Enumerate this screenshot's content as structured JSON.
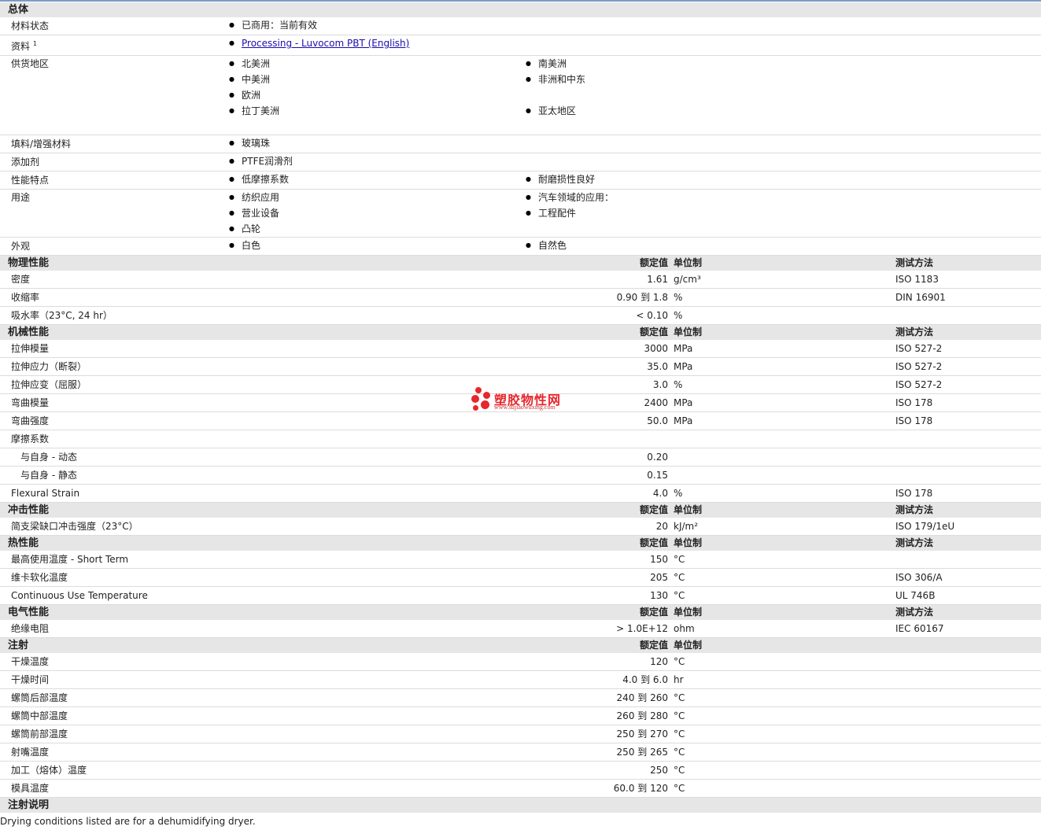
{
  "general": {
    "title": "总体",
    "rows": [
      {
        "label": "材料状态",
        "items": [
          "已商用：当前有效"
        ]
      },
      {
        "label": "资料",
        "sup": "1",
        "link": "Processing - Luvocom PBT (English)"
      },
      {
        "label": "供货地区",
        "items": [
          "北美洲",
          "南美洲",
          "中美洲",
          "非洲和中东",
          "欧洲",
          "",
          "拉丁美洲",
          "亚太地区",
          ""
        ]
      },
      {
        "label": "填料/增强材料",
        "items": [
          "玻璃珠"
        ]
      },
      {
        "label": "添加剂",
        "items": [
          "PTFE润滑剂"
        ]
      },
      {
        "label": "性能特点",
        "items": [
          "低摩擦系数",
          "耐磨损性良好"
        ]
      },
      {
        "label": "用途",
        "items": [
          "纺织应用",
          "汽车领域的应用：",
          "营业设备",
          "工程配件",
          "凸轮",
          ""
        ]
      },
      {
        "label": "外观",
        "items": [
          "白色",
          "自然色"
        ]
      }
    ]
  },
  "col_headers": {
    "value": "额定值",
    "unit": "单位制",
    "method": "测试方法"
  },
  "sections": [
    {
      "title": "物理性能",
      "show_method": true,
      "rows": [
        {
          "label": "密度",
          "value": "1.61",
          "unit": "g/cm³",
          "method": "ISO 1183"
        },
        {
          "label": "收缩率",
          "value": "0.90 到  1.8",
          "unit": "%",
          "method": "DIN 16901"
        },
        {
          "label": "吸水率（23°C, 24 hr）",
          "value": "< 0.10",
          "unit": "%",
          "method": ""
        }
      ]
    },
    {
      "title": "机械性能",
      "show_method": true,
      "rows": [
        {
          "label": "拉伸模量",
          "value": "3000",
          "unit": "MPa",
          "method": "ISO 527-2"
        },
        {
          "label": "拉伸应力（断裂）",
          "value": "35.0",
          "unit": "MPa",
          "method": "ISO 527-2"
        },
        {
          "label": "拉伸应变（屈服）",
          "value": "3.0",
          "unit": "%",
          "method": "ISO 527-2"
        },
        {
          "label": "弯曲模量",
          "value": "2400",
          "unit": "MPa",
          "method": "ISO 178"
        },
        {
          "label": "弯曲强度",
          "value": "50.0",
          "unit": "MPa",
          "method": "ISO 178"
        },
        {
          "label": "摩擦系数",
          "value": "",
          "unit": "",
          "method": ""
        },
        {
          "label": "与自身  - 动态",
          "value": "0.20",
          "unit": "",
          "method": "",
          "sub": true
        },
        {
          "label": "与自身  - 静态",
          "value": "0.15",
          "unit": "",
          "method": "",
          "sub": true
        },
        {
          "label": "Flexural Strain",
          "value": "4.0",
          "unit": "%",
          "method": "ISO 178"
        }
      ]
    },
    {
      "title": "冲击性能",
      "show_method": true,
      "rows": [
        {
          "label": "简支梁缺口冲击强度（23°C）",
          "value": "20",
          "unit": "kJ/m²",
          "method": "ISO 179/1eU"
        }
      ]
    },
    {
      "title": "热性能",
      "show_method": true,
      "rows": [
        {
          "label": "最高使用温度  - Short Term",
          "value": "150",
          "unit": "°C",
          "method": ""
        },
        {
          "label": "维卡软化温度",
          "value": "205",
          "unit": "°C",
          "method": "ISO 306/A"
        },
        {
          "label": "Continuous Use Temperature",
          "value": "130",
          "unit": "°C",
          "method": "UL 746B"
        }
      ]
    },
    {
      "title": "电气性能",
      "show_method": true,
      "rows": [
        {
          "label": "绝缘电阻",
          "value": "> 1.0E+12",
          "unit": "ohm",
          "method": "IEC 60167"
        }
      ]
    },
    {
      "title": "注射",
      "show_method": false,
      "rows": [
        {
          "label": "干燥温度",
          "value": "120",
          "unit": "°C",
          "method": ""
        },
        {
          "label": "干燥时间",
          "value": "4.0 到  6.0",
          "unit": "hr",
          "method": ""
        },
        {
          "label": "螺筒后部温度",
          "value": "240 到  260",
          "unit": "°C",
          "method": ""
        },
        {
          "label": "螺筒中部温度",
          "value": "260 到  280",
          "unit": "°C",
          "method": ""
        },
        {
          "label": "螺筒前部温度",
          "value": "250 到  270",
          "unit": "°C",
          "method": ""
        },
        {
          "label": "射嘴温度",
          "value": "250 到  265",
          "unit": "°C",
          "method": ""
        },
        {
          "label": "加工（熔体）温度",
          "value": "250",
          "unit": "°C",
          "method": ""
        },
        {
          "label": "模具温度",
          "value": "60.0 到  120",
          "unit": "°C",
          "method": ""
        }
      ]
    }
  ],
  "notes": {
    "title": "注射说明",
    "text": "Drying conditions listed are for a dehumidifying dryer."
  },
  "watermark": {
    "name": "塑胶物性网",
    "url": "www.sujiaowuxing.com",
    "color": "#e8262d"
  }
}
